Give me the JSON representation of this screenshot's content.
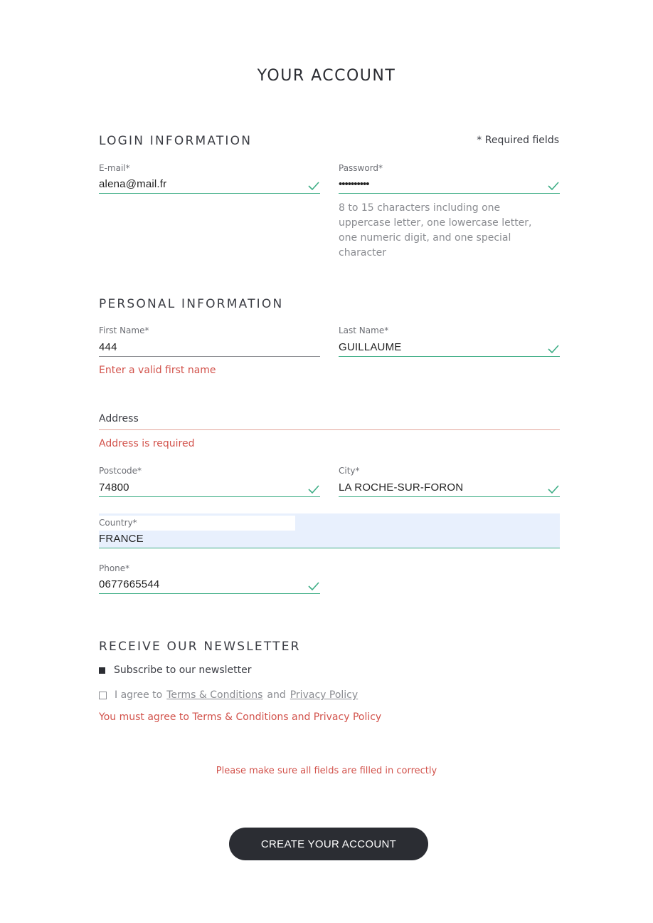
{
  "page": {
    "title": "YOUR ACCOUNT"
  },
  "login": {
    "title": "LOGIN INFORMATION",
    "required_note": "* Required fields",
    "email": {
      "label": "E-mail*",
      "value": "alena@mail.fr"
    },
    "password": {
      "label": "Password*",
      "value": "••••••••••",
      "hint": "8 to 15 characters including one uppercase letter, one lowercase letter, one numeric digit, and one special character"
    }
  },
  "personal": {
    "title": "PERSONAL INFORMATION",
    "first_name": {
      "label": "First Name*",
      "value": "444",
      "error": "Enter a valid first name"
    },
    "last_name": {
      "label": "Last Name*",
      "value": "GUILLAUME"
    },
    "address": {
      "label": "Address",
      "value": "",
      "error": "Address is required"
    },
    "postcode": {
      "label": "Postcode*",
      "value": "74800"
    },
    "city": {
      "label": "City*",
      "value": "LA ROCHE-SUR-FORON"
    },
    "country": {
      "label": "Country*",
      "value": "FRANCE"
    },
    "phone": {
      "label": "Phone*",
      "value": "0677665544"
    }
  },
  "newsletter": {
    "title": "RECEIVE OUR NEWSLETTER",
    "subscribe_label": "Subscribe to our newsletter",
    "agree_prefix": "I agree to",
    "terms_link": "Terms & Conditions",
    "and_word": "and",
    "privacy_link": "Privacy Policy",
    "agree_error": "You must agree to Terms & Conditions and Privacy Policy"
  },
  "form_error": "Please make sure all fields are filled in correctly",
  "submit_label": "CREATE YOUR ACCOUNT",
  "colors": {
    "valid": "#3fae86",
    "error": "#d2524b",
    "button": "#2b2d33",
    "autofill": "#e8f0fd"
  }
}
